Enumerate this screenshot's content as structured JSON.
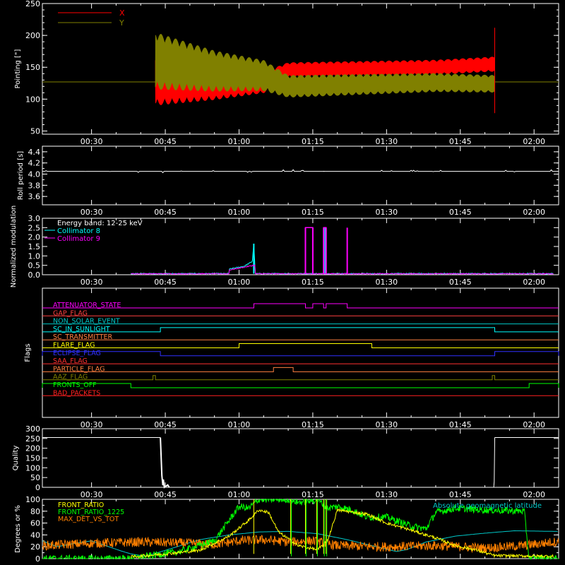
{
  "colors": {
    "background": "#000000",
    "axes": "#ffffff",
    "x_series": "#ff0000",
    "y_series": "#808000",
    "roll": "#ffffff",
    "energy": "#ffffff",
    "collimator8": "#00ffff",
    "collimator9": "#ff00ff",
    "front_ratio": "#ffff00",
    "front_ratio_1225": "#00ff00",
    "max_det": "#ff8000",
    "geolat": "#00c8c8",
    "quality": "#ffffff"
  },
  "time_axis": {
    "tmin_minutes": 20,
    "tmax_minutes": 125,
    "ticks": [
      {
        "t": 30,
        "label": "00:30"
      },
      {
        "t": 45,
        "label": "00:45"
      },
      {
        "t": 60,
        "label": "01:00"
      },
      {
        "t": 75,
        "label": "01:15"
      },
      {
        "t": 90,
        "label": "01:30"
      },
      {
        "t": 105,
        "label": "01:45"
      },
      {
        "t": 120,
        "label": "02:00"
      }
    ]
  },
  "chart_data": [
    {
      "id": "pointing",
      "type": "line",
      "ylabel": "Pointing [\"]",
      "ylim": [
        45,
        250
      ],
      "yticks": [
        50,
        100,
        150,
        200,
        250
      ],
      "ytick_labels": [
        "50",
        "100",
        "150",
        "200",
        "250"
      ],
      "series": [
        {
          "name": "X",
          "center": [
            [
              20,
              127
            ],
            [
              43,
              127
            ],
            [
              55,
              123
            ],
            [
              65,
              126
            ],
            [
              70,
              146
            ],
            [
              100,
              150
            ],
            [
              112,
              155
            ]
          ],
          "half_amplitude": [
            [
              43,
              38
            ],
            [
              55,
              25
            ],
            [
              65,
              17
            ],
            [
              70,
              12
            ],
            [
              112,
              12
            ]
          ]
        },
        {
          "name": "Y",
          "center": [
            [
              20,
              127
            ],
            [
              43,
              160
            ],
            [
              55,
              144
            ],
            [
              65,
              137
            ],
            [
              70,
              120
            ],
            [
              100,
              126
            ],
            [
              112,
              124
            ]
          ],
          "half_amplitude": [
            [
              43,
              46
            ],
            [
              55,
              33
            ],
            [
              65,
              25
            ],
            [
              70,
              18
            ],
            [
              112,
              14
            ]
          ]
        }
      ],
      "legend": [
        "X",
        "Y"
      ],
      "legend_position": "top-left"
    },
    {
      "id": "roll",
      "type": "line",
      "ylabel": "Roll period [s]",
      "ylim": [
        3.45,
        4.5
      ],
      "yticks": [
        3.6,
        3.8,
        4.0,
        4.2,
        4.4
      ],
      "ytick_labels": [
        "3.6",
        "3.8",
        "4.0",
        "4.2",
        "4.4"
      ],
      "series": [
        {
          "name": "",
          "baseline": 4.05
        }
      ]
    },
    {
      "id": "modulation",
      "type": "line",
      "ylabel": "Normalized modulation",
      "ylim": [
        0,
        3.0
      ],
      "yticks": [
        0,
        0.5,
        1.0,
        1.5,
        2.0,
        2.5,
        3.0
      ],
      "ytick_labels": [
        "0.0",
        "0.5",
        "1.0",
        "1.5",
        "2.0",
        "2.5",
        "3.0"
      ],
      "legend": [
        "Energy band: 12-25 keV",
        "Collimator 8",
        "Collimator 9"
      ],
      "legend_position": "top-left",
      "series": [
        {
          "name": "Collimator 8",
          "data_range": [
            38,
            124
          ],
          "baseline": 0.06,
          "points": [
            [
              58,
              0.3
            ],
            [
              61,
              0.45
            ],
            [
              62.7,
              0.7
            ],
            [
              63,
              1.65
            ],
            [
              63.2,
              0.6
            ],
            [
              75.8,
              0.1
            ],
            [
              77.5,
              2.5
            ],
            [
              77.8,
              0.2
            ]
          ]
        },
        {
          "name": "Collimator 9",
          "data_range": [
            38,
            124
          ],
          "baseline": 0.05,
          "points": [
            [
              58,
              0.25
            ],
            [
              61,
              0.4
            ],
            [
              63,
              0.5
            ],
            [
              73.5,
              2.5
            ],
            [
              75,
              2.5
            ],
            [
              77.2,
              2.5
            ],
            [
              77.7,
              2.5
            ],
            [
              82,
              2.5
            ],
            [
              83,
              0.25
            ]
          ]
        }
      ]
    },
    {
      "id": "flags",
      "type": "line",
      "ylabel": "Flags",
      "series": [
        {
          "name": "ATTENUATOR_STATE",
          "color": "#ff00ff",
          "high": [
            [
              63,
              73.5
            ],
            [
              75,
              77.2
            ],
            [
              77.7,
              82
            ]
          ]
        },
        {
          "name": "GAP_FLAG",
          "color": "#ff4040",
          "high": []
        },
        {
          "name": "NON_SOLAR_EVENT",
          "color": "#00c8c8",
          "high": []
        },
        {
          "name": "SC_IN_SUNLIGHT",
          "color": "#00ffff",
          "high": [
            [
              44,
              112
            ]
          ]
        },
        {
          "name": "SC_TRANSMITTER",
          "color": "#ff8040",
          "high": []
        },
        {
          "name": "FLARE_FLAG",
          "color": "#ffff00",
          "high": [
            [
              60,
              87
            ]
          ]
        },
        {
          "name": "ECLIPSE_FLAG",
          "color": "#3030ff",
          "high": [
            [
              20,
              44
            ],
            [
              112,
              125
            ]
          ]
        },
        {
          "name": "SAA_FLAG",
          "color": "#ff3030",
          "high": []
        },
        {
          "name": "PARTICLE_FLAG",
          "color": "#ff8040",
          "high": [
            [
              67,
              71
            ]
          ]
        },
        {
          "name": "AAZ_FLAG",
          "color": "#808000",
          "high": [
            [
              42.5,
              43
            ],
            [
              111.5,
              112
            ]
          ]
        },
        {
          "name": "FRONTS_OFF",
          "color": "#00ff00",
          "high": [
            [
              20,
              38
            ],
            [
              119,
              125
            ]
          ]
        },
        {
          "name": "BAD_PACKETS",
          "color": "#ff2020",
          "high": []
        }
      ]
    },
    {
      "id": "quality",
      "type": "bar",
      "ylabel": "Quality",
      "ylim": [
        0,
        300
      ],
      "yticks": [
        0,
        50,
        100,
        150,
        200,
        250,
        300
      ],
      "ytick_labels": [
        "0",
        "50",
        "100",
        "150",
        "200",
        "250",
        "300"
      ],
      "segments": [
        [
          20,
          44,
          255
        ],
        [
          112,
          125,
          255
        ]
      ]
    },
    {
      "id": "ratios",
      "type": "line",
      "ylabel": "Degrees or %",
      "ylim": [
        0,
        100
      ],
      "yticks": [
        0,
        20,
        40,
        60,
        80,
        100
      ],
      "ytick_labels": [
        "0",
        "20",
        "40",
        "60",
        "80",
        "100"
      ],
      "legend": [
        "FRONT_RATIO",
        "FRONT_RATIO_1225",
        "MAX_DET_VS_TOT"
      ],
      "legend_position": "top-left",
      "annotation": "Absolute geomagnetic latitude",
      "series": [
        {
          "name": "FRONT_RATIO",
          "points": [
            [
              38,
              3
            ],
            [
              45,
              8
            ],
            [
              52,
              14
            ],
            [
              58,
              38
            ],
            [
              62,
              65
            ],
            [
              64,
              82
            ],
            [
              66,
              78
            ],
            [
              68,
              45
            ],
            [
              72,
              22
            ],
            [
              76,
              15
            ],
            [
              78,
              30
            ],
            [
              80,
              82
            ],
            [
              86,
              75
            ],
            [
              90,
              60
            ],
            [
              95,
              48
            ],
            [
              100,
              35
            ],
            [
              104,
              22
            ],
            [
              108,
              15
            ],
            [
              112,
              5
            ],
            [
              124,
              4
            ]
          ],
          "steps": [
            [
              63,
              100
            ],
            [
              70.5,
              8
            ],
            [
              73.5,
              100
            ],
            [
              75.8,
              8
            ],
            [
              77.2,
              100
            ],
            [
              77.7,
              8
            ]
          ]
        },
        {
          "name": "FRONT_RATIO_1225",
          "points": [
            [
              20,
              0
            ],
            [
              38,
              0
            ],
            [
              42,
              5
            ],
            [
              48,
              12
            ],
            [
              55,
              30
            ],
            [
              60,
              88
            ],
            [
              62,
              85
            ],
            [
              64,
              100
            ],
            [
              70,
              100
            ],
            [
              72,
              95
            ],
            [
              76,
              99
            ],
            [
              78,
              85
            ],
            [
              80,
              88
            ],
            [
              83,
              82
            ],
            [
              86,
              70
            ],
            [
              90,
              70
            ],
            [
              95,
              55
            ],
            [
              98,
              50
            ],
            [
              100,
              78
            ],
            [
              104,
              85
            ],
            [
              110,
              82
            ],
            [
              118,
              80
            ],
            [
              119,
              0
            ],
            [
              124,
              0
            ]
          ],
          "steps": [
            [
              70.5,
              4
            ],
            [
              73.5,
              100
            ],
            [
              75.8,
              4
            ],
            [
              77.2,
              100
            ],
            [
              77.7,
              4
            ]
          ]
        },
        {
          "name": "MAX_DET_VS_TOT",
          "points": [
            [
              20,
              22
            ],
            [
              30,
              26
            ],
            [
              40,
              28
            ],
            [
              50,
              26
            ],
            [
              55,
              24
            ],
            [
              60,
              30
            ],
            [
              65,
              32
            ],
            [
              70,
              28
            ],
            [
              75,
              30
            ],
            [
              80,
              22
            ],
            [
              90,
              20
            ],
            [
              100,
              22
            ],
            [
              110,
              18
            ],
            [
              118,
              22
            ],
            [
              124,
              28
            ]
          ]
        },
        {
          "name": "Absolute geomagnetic latitude",
          "points": [
            [
              20,
              30
            ],
            [
              23,
              20
            ],
            [
              26,
              25
            ],
            [
              30,
              30
            ],
            [
              36,
              13
            ],
            [
              38,
              8
            ],
            [
              41,
              4
            ],
            [
              45,
              14
            ],
            [
              52,
              32
            ],
            [
              58,
              40
            ],
            [
              64,
              45
            ],
            [
              70,
              46
            ],
            [
              76,
              42
            ],
            [
              82,
              32
            ],
            [
              88,
              20
            ],
            [
              92,
              12
            ],
            [
              94,
              15
            ],
            [
              98,
              28
            ],
            [
              104,
              38
            ],
            [
              110,
              43
            ],
            [
              116,
              47
            ],
            [
              124,
              46
            ]
          ]
        }
      ]
    }
  ]
}
